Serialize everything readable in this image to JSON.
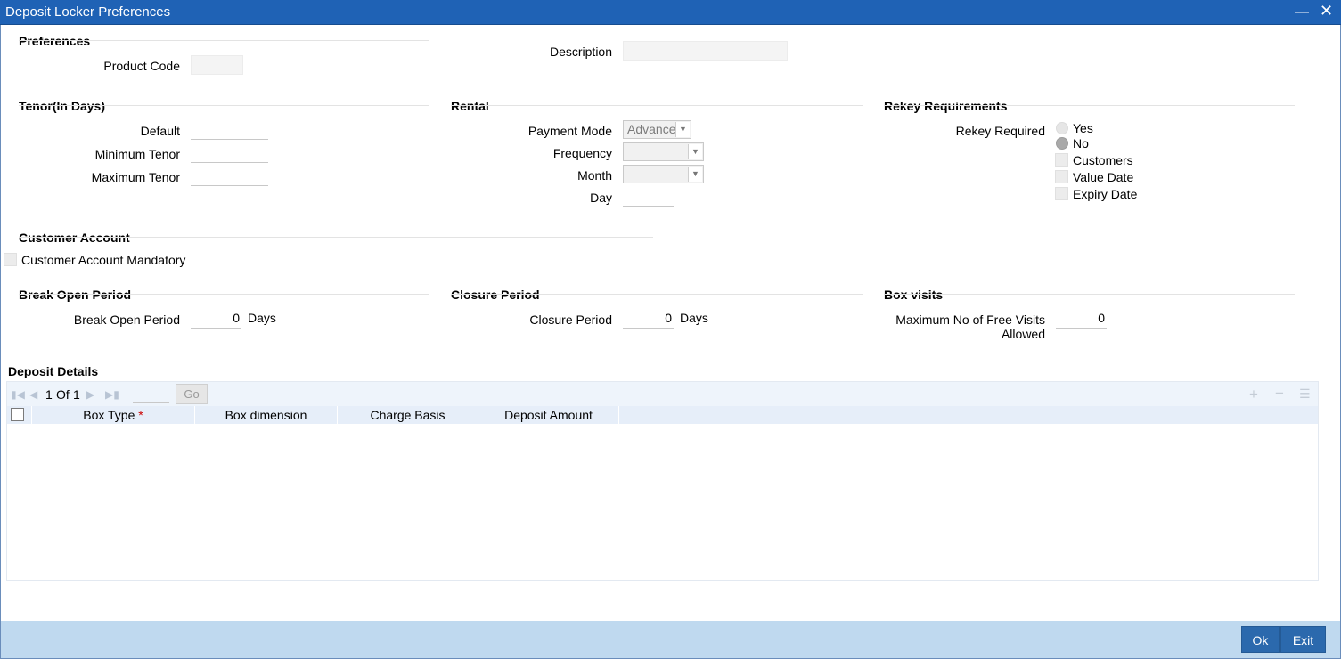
{
  "window": {
    "title": "Deposit Locker Preferences"
  },
  "preferences": {
    "heading": "Preferences",
    "product_code_label": "Product Code",
    "product_code_value": "",
    "description_label": "Description",
    "description_value": ""
  },
  "tenor": {
    "heading": "Tenor(In Days)",
    "default_label": "Default",
    "default_value": "",
    "min_label": "Minimum Tenor",
    "min_value": "",
    "max_label": "Maximum Tenor",
    "max_value": ""
  },
  "rental": {
    "heading": "Rental",
    "payment_mode_label": "Payment Mode",
    "payment_mode_value": "Advance",
    "frequency_label": "Frequency",
    "frequency_value": "",
    "month_label": "Month",
    "month_value": "",
    "day_label": "Day",
    "day_value": ""
  },
  "rekey": {
    "heading": "Rekey Requirements",
    "required_label": "Rekey Required",
    "yes_label": "Yes",
    "no_label": "No",
    "selected": "No",
    "customers_label": "Customers",
    "value_date_label": "Value Date",
    "expiry_date_label": "Expiry Date"
  },
  "customer_account": {
    "heading": "Customer Account",
    "mandatory_label": "Customer Account Mandatory"
  },
  "break_open": {
    "heading": "Break Open Period",
    "label": "Break Open Period",
    "value": "0",
    "unit": "Days"
  },
  "closure": {
    "heading": "Closure Period",
    "label": "Closure Period",
    "value": "0",
    "unit": "Days"
  },
  "box_visits": {
    "heading": "Box visits",
    "label_line1": "Maximum No of Free Visits",
    "label_line2": "Allowed",
    "value": "0"
  },
  "deposit_details": {
    "heading": "Deposit Details",
    "page_current": "1",
    "page_of": "Of",
    "page_total": "1",
    "page_input": "",
    "go_label": "Go",
    "columns": [
      "Box Type",
      "Box dimension",
      "Charge Basis",
      "Deposit Amount"
    ],
    "required_mark": "*",
    "rows": []
  },
  "footer": {
    "ok_label": "Ok",
    "exit_label": "Exit"
  },
  "colors": {
    "titlebar": "#1f62b5",
    "footer": "#bfd9ef",
    "button": "#2b69ad",
    "required": "#cc0000"
  }
}
